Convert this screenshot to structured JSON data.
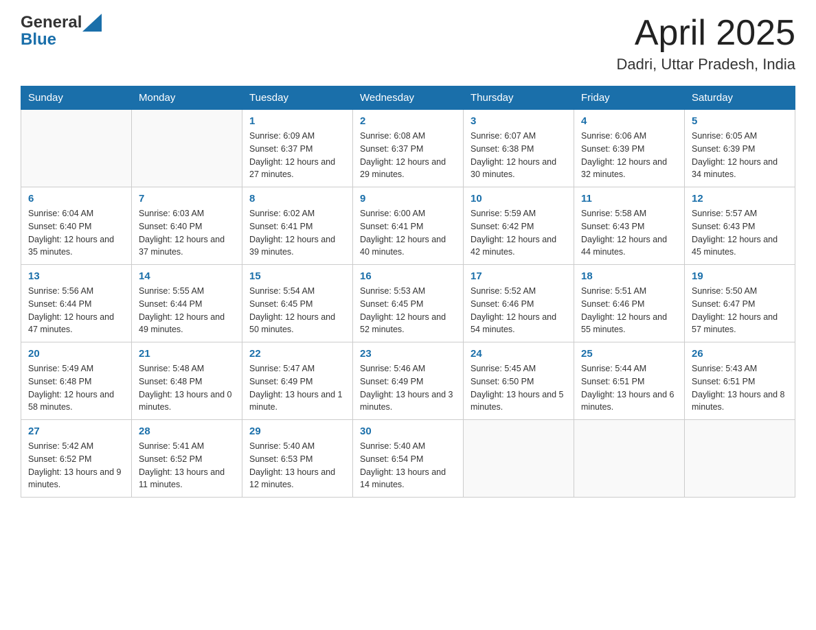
{
  "header": {
    "logo_general": "General",
    "logo_blue": "Blue",
    "month_title": "April 2025",
    "location": "Dadri, Uttar Pradesh, India"
  },
  "calendar": {
    "days_of_week": [
      "Sunday",
      "Monday",
      "Tuesday",
      "Wednesday",
      "Thursday",
      "Friday",
      "Saturday"
    ],
    "weeks": [
      [
        {
          "day": "",
          "sunrise": "",
          "sunset": "",
          "daylight": ""
        },
        {
          "day": "",
          "sunrise": "",
          "sunset": "",
          "daylight": ""
        },
        {
          "day": "1",
          "sunrise": "Sunrise: 6:09 AM",
          "sunset": "Sunset: 6:37 PM",
          "daylight": "Daylight: 12 hours and 27 minutes."
        },
        {
          "day": "2",
          "sunrise": "Sunrise: 6:08 AM",
          "sunset": "Sunset: 6:37 PM",
          "daylight": "Daylight: 12 hours and 29 minutes."
        },
        {
          "day": "3",
          "sunrise": "Sunrise: 6:07 AM",
          "sunset": "Sunset: 6:38 PM",
          "daylight": "Daylight: 12 hours and 30 minutes."
        },
        {
          "day": "4",
          "sunrise": "Sunrise: 6:06 AM",
          "sunset": "Sunset: 6:39 PM",
          "daylight": "Daylight: 12 hours and 32 minutes."
        },
        {
          "day": "5",
          "sunrise": "Sunrise: 6:05 AM",
          "sunset": "Sunset: 6:39 PM",
          "daylight": "Daylight: 12 hours and 34 minutes."
        }
      ],
      [
        {
          "day": "6",
          "sunrise": "Sunrise: 6:04 AM",
          "sunset": "Sunset: 6:40 PM",
          "daylight": "Daylight: 12 hours and 35 minutes."
        },
        {
          "day": "7",
          "sunrise": "Sunrise: 6:03 AM",
          "sunset": "Sunset: 6:40 PM",
          "daylight": "Daylight: 12 hours and 37 minutes."
        },
        {
          "day": "8",
          "sunrise": "Sunrise: 6:02 AM",
          "sunset": "Sunset: 6:41 PM",
          "daylight": "Daylight: 12 hours and 39 minutes."
        },
        {
          "day": "9",
          "sunrise": "Sunrise: 6:00 AM",
          "sunset": "Sunset: 6:41 PM",
          "daylight": "Daylight: 12 hours and 40 minutes."
        },
        {
          "day": "10",
          "sunrise": "Sunrise: 5:59 AM",
          "sunset": "Sunset: 6:42 PM",
          "daylight": "Daylight: 12 hours and 42 minutes."
        },
        {
          "day": "11",
          "sunrise": "Sunrise: 5:58 AM",
          "sunset": "Sunset: 6:43 PM",
          "daylight": "Daylight: 12 hours and 44 minutes."
        },
        {
          "day": "12",
          "sunrise": "Sunrise: 5:57 AM",
          "sunset": "Sunset: 6:43 PM",
          "daylight": "Daylight: 12 hours and 45 minutes."
        }
      ],
      [
        {
          "day": "13",
          "sunrise": "Sunrise: 5:56 AM",
          "sunset": "Sunset: 6:44 PM",
          "daylight": "Daylight: 12 hours and 47 minutes."
        },
        {
          "day": "14",
          "sunrise": "Sunrise: 5:55 AM",
          "sunset": "Sunset: 6:44 PM",
          "daylight": "Daylight: 12 hours and 49 minutes."
        },
        {
          "day": "15",
          "sunrise": "Sunrise: 5:54 AM",
          "sunset": "Sunset: 6:45 PM",
          "daylight": "Daylight: 12 hours and 50 minutes."
        },
        {
          "day": "16",
          "sunrise": "Sunrise: 5:53 AM",
          "sunset": "Sunset: 6:45 PM",
          "daylight": "Daylight: 12 hours and 52 minutes."
        },
        {
          "day": "17",
          "sunrise": "Sunrise: 5:52 AM",
          "sunset": "Sunset: 6:46 PM",
          "daylight": "Daylight: 12 hours and 54 minutes."
        },
        {
          "day": "18",
          "sunrise": "Sunrise: 5:51 AM",
          "sunset": "Sunset: 6:46 PM",
          "daylight": "Daylight: 12 hours and 55 minutes."
        },
        {
          "day": "19",
          "sunrise": "Sunrise: 5:50 AM",
          "sunset": "Sunset: 6:47 PM",
          "daylight": "Daylight: 12 hours and 57 minutes."
        }
      ],
      [
        {
          "day": "20",
          "sunrise": "Sunrise: 5:49 AM",
          "sunset": "Sunset: 6:48 PM",
          "daylight": "Daylight: 12 hours and 58 minutes."
        },
        {
          "day": "21",
          "sunrise": "Sunrise: 5:48 AM",
          "sunset": "Sunset: 6:48 PM",
          "daylight": "Daylight: 13 hours and 0 minutes."
        },
        {
          "day": "22",
          "sunrise": "Sunrise: 5:47 AM",
          "sunset": "Sunset: 6:49 PM",
          "daylight": "Daylight: 13 hours and 1 minute."
        },
        {
          "day": "23",
          "sunrise": "Sunrise: 5:46 AM",
          "sunset": "Sunset: 6:49 PM",
          "daylight": "Daylight: 13 hours and 3 minutes."
        },
        {
          "day": "24",
          "sunrise": "Sunrise: 5:45 AM",
          "sunset": "Sunset: 6:50 PM",
          "daylight": "Daylight: 13 hours and 5 minutes."
        },
        {
          "day": "25",
          "sunrise": "Sunrise: 5:44 AM",
          "sunset": "Sunset: 6:51 PM",
          "daylight": "Daylight: 13 hours and 6 minutes."
        },
        {
          "day": "26",
          "sunrise": "Sunrise: 5:43 AM",
          "sunset": "Sunset: 6:51 PM",
          "daylight": "Daylight: 13 hours and 8 minutes."
        }
      ],
      [
        {
          "day": "27",
          "sunrise": "Sunrise: 5:42 AM",
          "sunset": "Sunset: 6:52 PM",
          "daylight": "Daylight: 13 hours and 9 minutes."
        },
        {
          "day": "28",
          "sunrise": "Sunrise: 5:41 AM",
          "sunset": "Sunset: 6:52 PM",
          "daylight": "Daylight: 13 hours and 11 minutes."
        },
        {
          "day": "29",
          "sunrise": "Sunrise: 5:40 AM",
          "sunset": "Sunset: 6:53 PM",
          "daylight": "Daylight: 13 hours and 12 minutes."
        },
        {
          "day": "30",
          "sunrise": "Sunrise: 5:40 AM",
          "sunset": "Sunset: 6:54 PM",
          "daylight": "Daylight: 13 hours and 14 minutes."
        },
        {
          "day": "",
          "sunrise": "",
          "sunset": "",
          "daylight": ""
        },
        {
          "day": "",
          "sunrise": "",
          "sunset": "",
          "daylight": ""
        },
        {
          "day": "",
          "sunrise": "",
          "sunset": "",
          "daylight": ""
        }
      ]
    ]
  }
}
